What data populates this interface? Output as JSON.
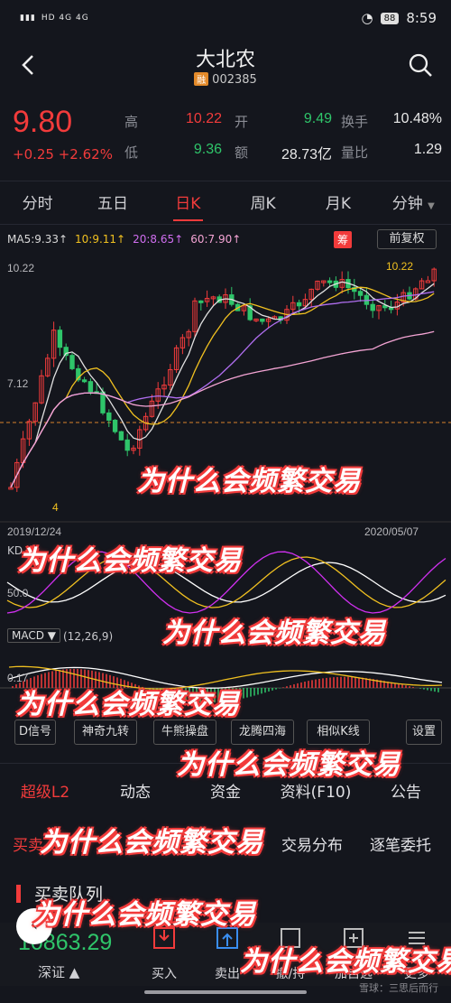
{
  "status": {
    "left": "HD 4G 4G",
    "battery": "88",
    "time": "8:59"
  },
  "header": {
    "title": "大北农",
    "badge": "融",
    "code": "002385"
  },
  "quote": {
    "price": "9.80",
    "change": "+0.25 +2.62%",
    "rows": [
      {
        "label1": "高",
        "val1": "10.22",
        "label2": "开",
        "val2": "9.49",
        "label3": "换手",
        "val3": "10.48%"
      },
      {
        "label1": "低",
        "val1": "9.36",
        "label2": "额",
        "val2": "28.73亿",
        "label3": "量比",
        "val3": "1.29"
      }
    ]
  },
  "tabs": [
    "分时",
    "五日",
    "日K",
    "周K",
    "月K",
    "分钟"
  ],
  "active_tab": "日K",
  "ma": {
    "ma5": "MA5:9.33↑",
    "ma10": "10:9.11↑",
    "ma20": "20:8.65↑",
    "ma60": "60:7.90↑"
  },
  "chart_controls": {
    "chou": "筹",
    "fuquan": "前复权"
  },
  "chart_axis": {
    "high": "10.22",
    "mid": "7.12",
    "high_right": "10.22",
    "date_left": "2019/12/24",
    "date_right": "2020/05/07",
    "low_left": "4",
    "kdj_label": "KD",
    "kdj_val": "50.0",
    "macd_label": "MACD ▼",
    "macd_params": "(12,26,9)",
    "macd_val": "0.17"
  },
  "chart_data": {
    "type": "candlestick",
    "x_start": "2019/12/24",
    "x_end": "2020/05/07",
    "high": 10.22,
    "ma": {
      "ma5": 9.33,
      "ma10": 9.11,
      "ma20": 8.65,
      "ma60": 7.9
    }
  },
  "tools": [
    "D信号",
    "神奇九转",
    "牛熊操盘",
    "龙腾四海",
    "相似K线",
    "设置"
  ],
  "bottom_tabs": [
    "超级L2",
    "动态",
    "资金",
    "资料(F10)",
    "公告"
  ],
  "sub_tabs": [
    "买卖",
    "交易分布",
    "逐笔委托"
  ],
  "section_title": "买卖队列",
  "bottom_nav": {
    "index_value": "10863.29",
    "index_name": "深证 ▲",
    "items": [
      "买入",
      "卖出",
      "撤/持",
      "加自选",
      "更多"
    ]
  },
  "overlay": "为什么会频繁交易",
  "watermark": "雪球：三思后而行"
}
